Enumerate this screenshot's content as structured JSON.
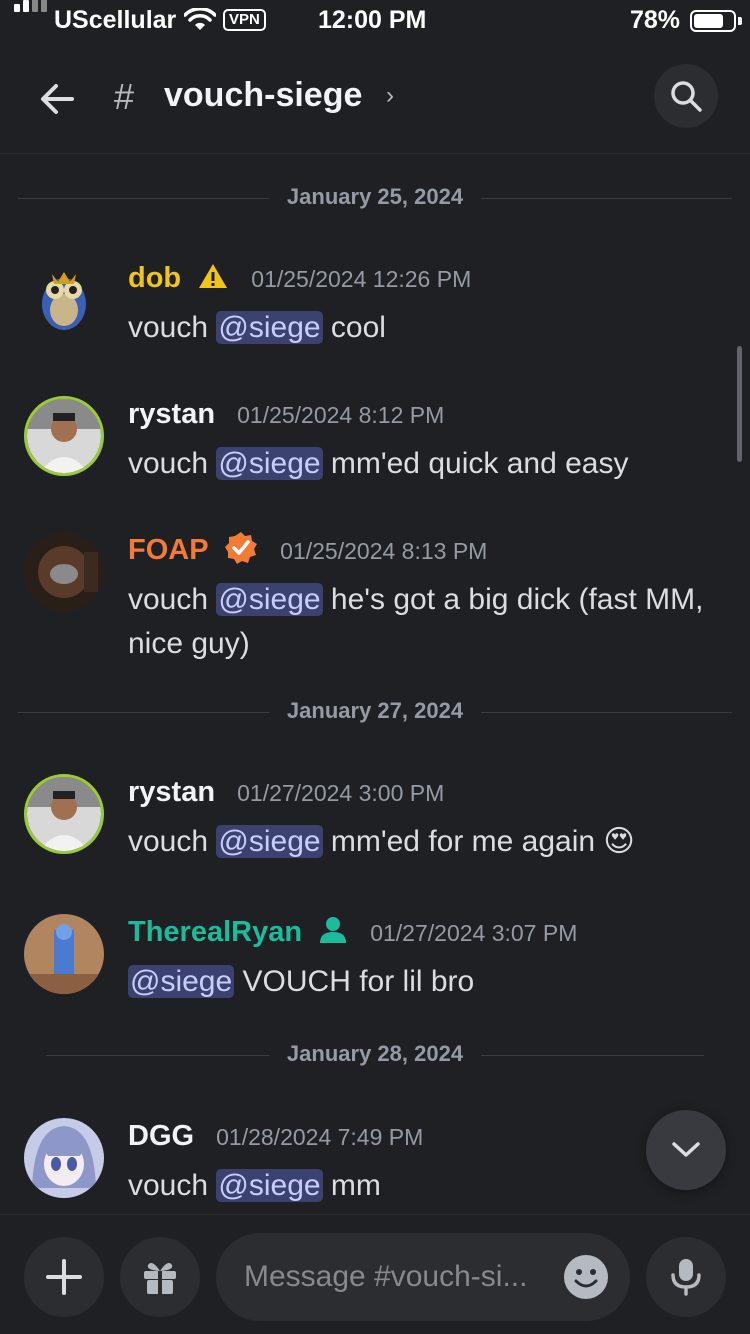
{
  "status_bar": {
    "carrier": "UScellular",
    "vpn": "VPN",
    "time": "12:00 PM",
    "battery": "78%",
    "battery_level": 0.78
  },
  "header": {
    "hash": "#",
    "channel": "vouch-siege",
    "chevron": "›",
    "icons": [
      "back-arrow-icon",
      "search-icon"
    ]
  },
  "dividers": [
    {
      "date": "January 25, 2024"
    },
    {
      "date": "January 27, 2024"
    },
    {
      "date": "January 28, 2024"
    }
  ],
  "messages": [
    {
      "user": "dob",
      "color": "#f0c419",
      "time": "01/25/2024 12:26 PM",
      "pre": "vouch ",
      "mention": "@siege",
      "post": " cool",
      "badge": "warning-icon"
    },
    {
      "user": "rystan",
      "color": "#f2f3f5",
      "time": "01/25/2024 8:12 PM",
      "pre": "vouch ",
      "mention": "@siege",
      "post": " mm'ed quick and easy"
    },
    {
      "user": "FOAP",
      "color": "#f47b34",
      "time": "01/25/2024 8:13 PM",
      "pre": "vouch ",
      "mention": "@siege",
      "post": " he's got a big dick (fast MM, nice guy)",
      "badge": "verified-icon"
    },
    {
      "user": "rystan",
      "color": "#f2f3f5",
      "time": "01/27/2024 3:00 PM",
      "pre": "vouch ",
      "mention": "@siege",
      "post": " mm'ed for me again 😍"
    },
    {
      "user": "TherealRyan",
      "color": "#1abc9c",
      "time": "01/27/2024 3:07 PM",
      "pre": "",
      "mention": "@siege",
      "post": " VOUCH for lil bro",
      "badge": "person-icon"
    },
    {
      "user": "DGG",
      "color": "#f2f3f5",
      "time": "01/28/2024 7:49 PM",
      "pre": "vouch ",
      "mention": "@siege",
      "post": "  mm"
    }
  ],
  "composer": {
    "placeholder": "Message #vouch-si...",
    "icons": [
      "plus-icon",
      "gift-icon",
      "emoji-icon",
      "microphone-icon"
    ]
  }
}
